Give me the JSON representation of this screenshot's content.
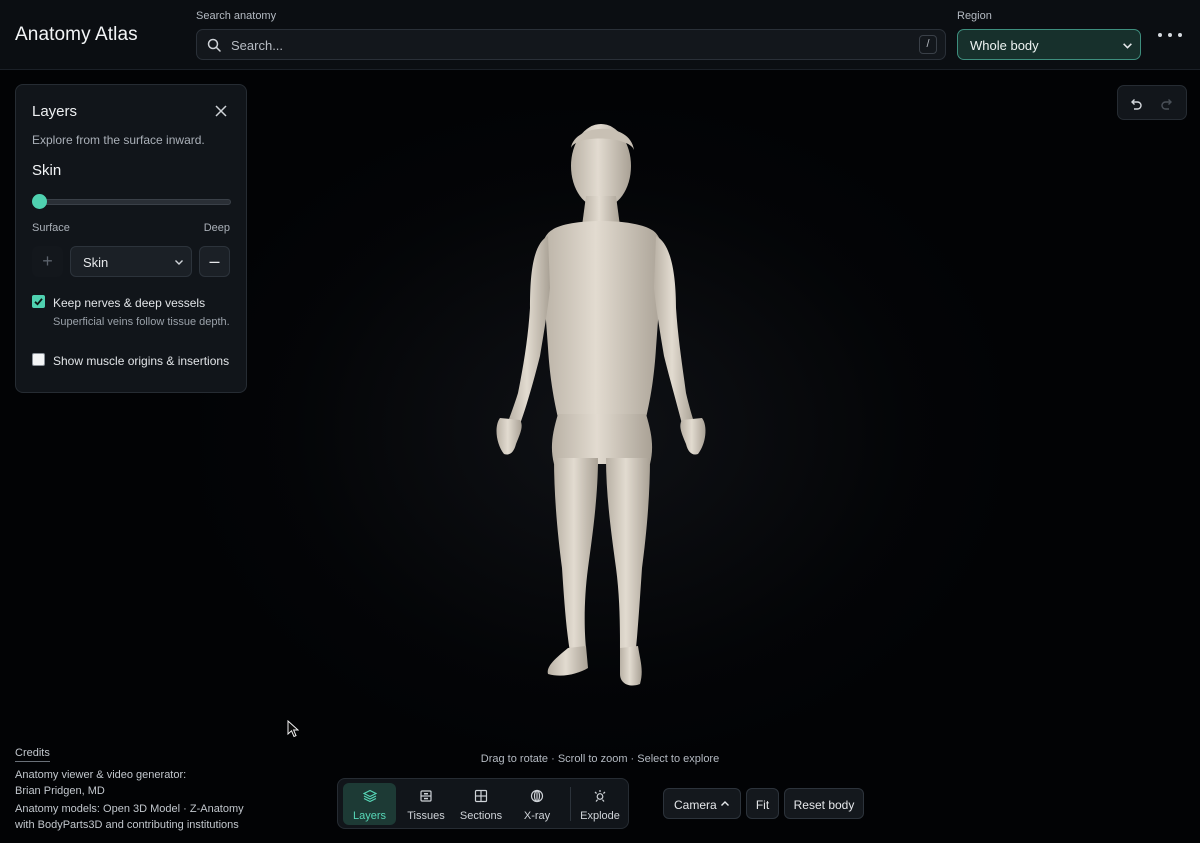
{
  "header": {
    "app_title": "Anatomy Atlas",
    "search": {
      "label": "Search anatomy",
      "placeholder": "Search...",
      "shortcut": "/"
    },
    "region": {
      "label": "Region",
      "value": "Whole body"
    }
  },
  "layers_panel": {
    "title": "Layers",
    "description": "Explore from the surface inward.",
    "current_layer": "Skin",
    "depth_slider": {
      "value": 0,
      "min_label": "Surface",
      "max_label": "Deep"
    },
    "layer_select_value": "Skin",
    "add_label": "+",
    "remove_label": "–",
    "keep_nerves": {
      "label": "Keep nerves & deep vessels",
      "checked": true,
      "help": "Superficial veins follow tissue depth."
    },
    "show_origins": {
      "label": "Show muscle origins & insertions",
      "checked": false
    }
  },
  "hint": "Drag to rotate · Scroll to zoom · Select to explore",
  "credits": {
    "title": "Credits",
    "lines": [
      "Anatomy viewer & video generator:",
      "Brian Pridgen, MD",
      "Anatomy models: Open 3D Model · Z-Anatomy",
      "with BodyParts3D and contributing institutions"
    ]
  },
  "toolbar": {
    "tools": [
      {
        "label": "Layers",
        "icon": "layers-icon",
        "active": true
      },
      {
        "label": "Tissues",
        "icon": "tissues-icon",
        "active": false
      },
      {
        "label": "Sections",
        "icon": "sections-icon",
        "active": false
      },
      {
        "label": "X-ray",
        "icon": "xray-icon",
        "active": false
      },
      {
        "label": "Explode",
        "icon": "explode-icon",
        "active": false
      }
    ]
  },
  "camera_label": "Camera",
  "fit_label": "Fit",
  "reset_label": "Reset body",
  "colors": {
    "accent": "#4fd1b0",
    "region_bg": "#17302c",
    "skin": "#d9d2c6",
    "background": "#020305"
  }
}
